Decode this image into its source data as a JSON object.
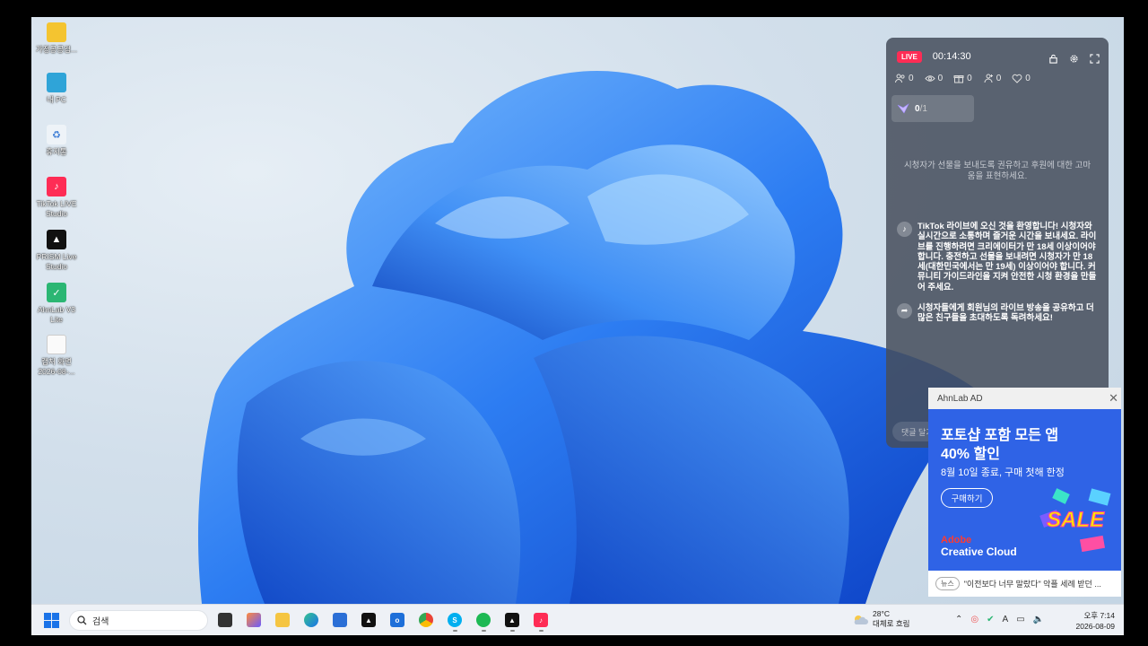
{
  "desktop": {
    "icons": [
      {
        "label": "가정공공검..."
      },
      {
        "label": "내 PC"
      },
      {
        "label": "휴지통"
      },
      {
        "label": "TikTok LIVE Studio"
      },
      {
        "label": "PRISM Live Studio"
      },
      {
        "label": "AhnLab V3 Lite"
      },
      {
        "label": "캡처 화면 2026-08-..."
      }
    ]
  },
  "live_panel": {
    "badge": "LIVE",
    "timer": "00:14:30",
    "stats": {
      "viewers": "0",
      "views": "0",
      "gifts": "0",
      "new_followers": "0",
      "likes": "0"
    },
    "goal": {
      "current": "0",
      "total": "/1"
    },
    "hint": "시청자가 선물을 보내도록 권유하고 후원에 대한 고마움을 표현하세요.",
    "messages": [
      {
        "text": "TikTok 라이브에 오신 것을 환영합니다! 시청자와 실시간으로 소통하며 즐거운 시간을 보내세요. 라이브를 진행하려면 크리에이터가 만 18세 이상이어야 합니다. 충전하고 선물을 보내려면 시청자가 만 18세(대한민국에서는 만 19세) 이상이어야 합니다. 커뮤니티 가이드라인을 지켜 안전한 시청 환경을 만들어 주세요."
      },
      {
        "text": "시청자들에게 회원님의 라이브 방송을 공유하고 더 많은 친구들을 초대하도록 독려하세요!"
      }
    ],
    "comment_placeholder": "댓글 달기"
  },
  "ad": {
    "header": "AhnLab AD",
    "headline1": "포토샵 포함 모든 앱",
    "headline2": "40% 할인",
    "subline": "8월 10일 종료, 구매 첫해 한정",
    "button": "구매하기",
    "brand1": "Adobe",
    "brand2": "Creative Cloud",
    "sale": "SALE",
    "news_tag": "뉴스",
    "news_text": "\"이전보다 너무 말랐다\" 악플 세례 받던 ..."
  },
  "taskbar": {
    "search_placeholder": "검색",
    "weather_temp": "28°C",
    "weather_desc": "대체로 흐림",
    "time": "오후 7:14",
    "date": "2026-08-09"
  }
}
